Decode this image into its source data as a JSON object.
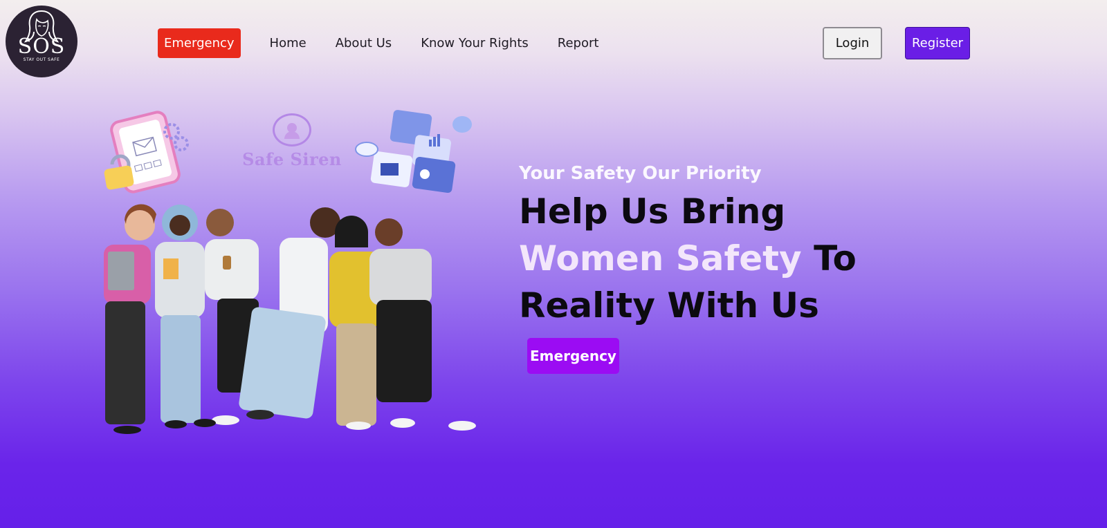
{
  "logo": {
    "title": "SOS",
    "subtitle": "STAY OUT SAFE"
  },
  "nav": {
    "emergency_label": "Emergency",
    "links": [
      "Home",
      "About Us",
      "Know Your Rights",
      "Report"
    ]
  },
  "auth": {
    "login_label": "Login",
    "register_label": "Register"
  },
  "hero": {
    "brand_name": "Safe Siren",
    "tagline": "Your Safety Our Priority",
    "headline_line1": "Help Us Bring",
    "headline_highlight": "Women Safety",
    "headline_line2_rest": " To",
    "headline_line3": "Reality With Us",
    "cta_label": "Emergency"
  },
  "colors": {
    "nav_emergency": "#e92a1c",
    "register": "#6a1ee6",
    "cta": "#9b0cf3",
    "highlight_text": "#f3e6fb"
  },
  "icons": [
    "woman-face-icon",
    "phone-mail-icon",
    "padlock-icon",
    "gear-icon",
    "puzzle-icon",
    "chat-bubble-icon",
    "location-pin-icon"
  ]
}
